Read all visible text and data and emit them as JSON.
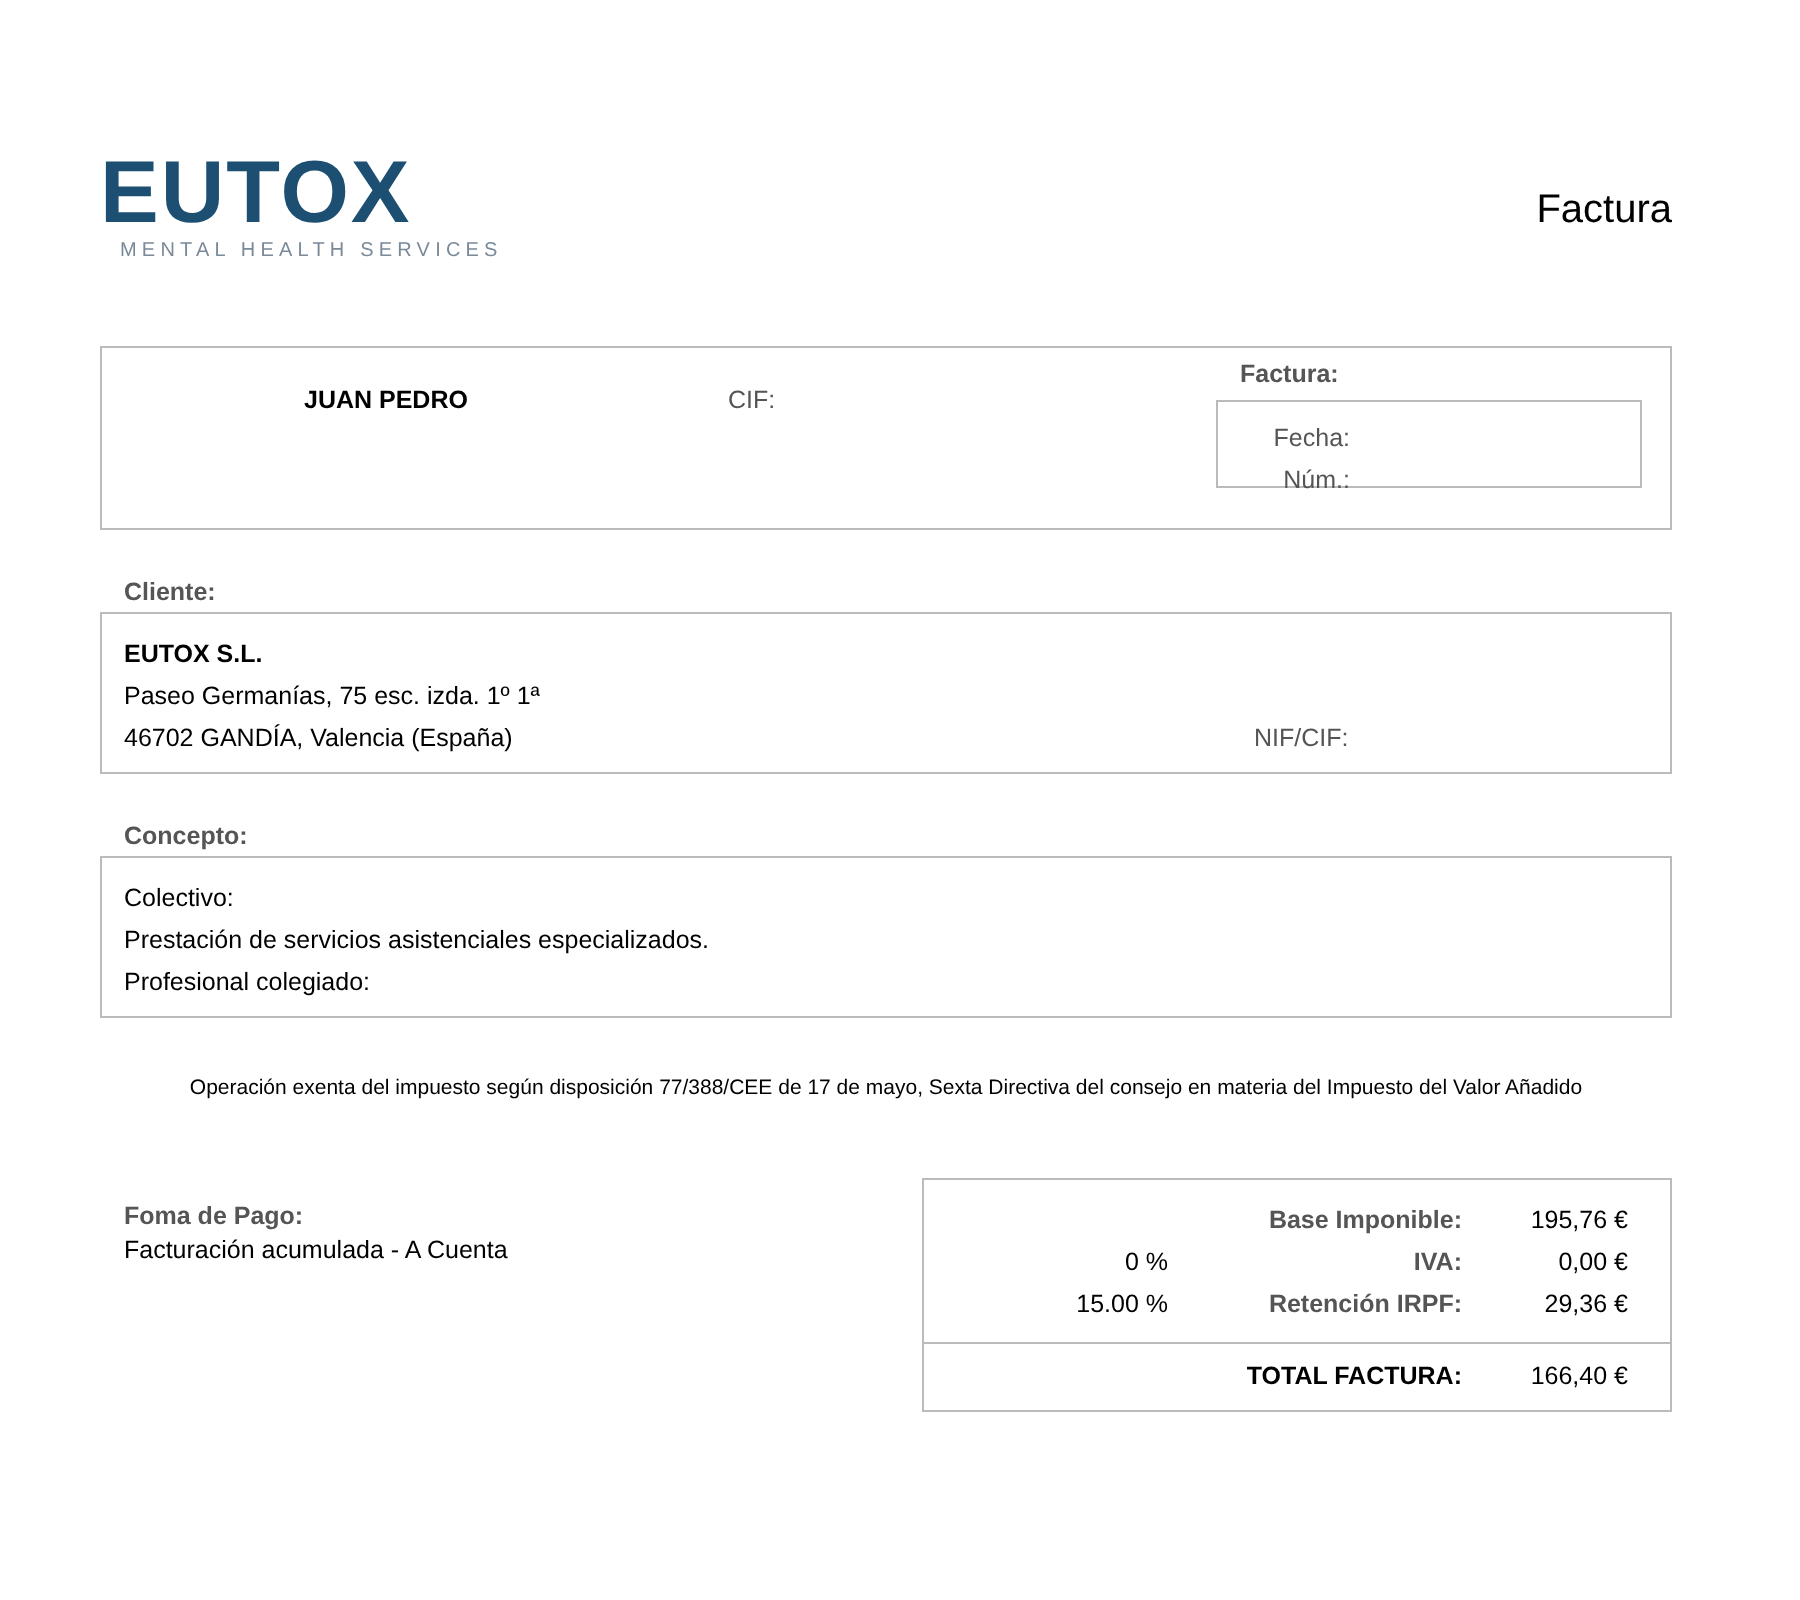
{
  "logo": {
    "name": "EUTOX",
    "tagline": "MENTAL HEALTH SERVICES"
  },
  "document_title": "Factura",
  "issuer": {
    "name": "JUAN PEDRO",
    "cif_label": "CIF:"
  },
  "invoice": {
    "heading": "Factura:",
    "fields": [
      "Fecha:",
      "Núm.:"
    ]
  },
  "client": {
    "heading": "Cliente:",
    "name": "EUTOX S.L.",
    "address_lines": [
      "Paseo Germanías, 75 esc. izda. 1º 1ª",
      "46702 GANDÍA, Valencia (España)"
    ],
    "nif_label": "NIF/CIF:"
  },
  "concept": {
    "heading": "Concepto:",
    "lines": [
      "Colectivo:",
      "Prestación de servicios asistenciales especializados.",
      "Profesional colegiado:"
    ]
  },
  "tax_note": "Operación exenta del impuesto según disposición 77/388/CEE de 17 de mayo, Sexta Directiva del consejo en materia del Impuesto del Valor Añadido",
  "payment": {
    "heading": "Foma de Pago:",
    "method": "Facturación acumulada - A Cuenta"
  },
  "totals": {
    "rows": [
      {
        "rate": "",
        "label": "Base Imponible:",
        "amount": "195,76 €"
      },
      {
        "rate": "0 %",
        "label": "IVA:",
        "amount": "0,00 €"
      },
      {
        "rate": "15.00 %",
        "label": "Retención IRPF:",
        "amount": "29,36 €"
      }
    ],
    "total": {
      "label": "TOTAL FACTURA:",
      "amount": "166,40 €"
    }
  }
}
